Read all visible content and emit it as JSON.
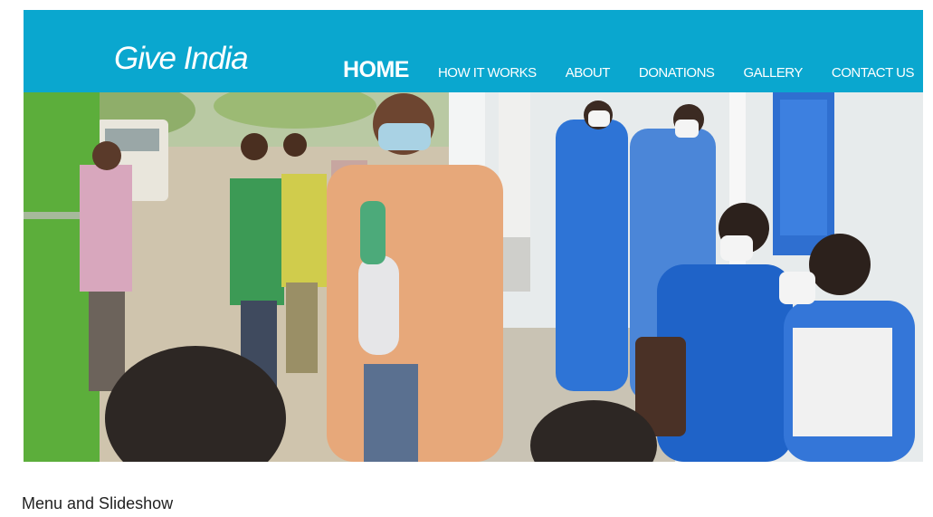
{
  "header": {
    "logo": "Give India",
    "nav": [
      {
        "label": "HOME",
        "active": true
      },
      {
        "label": "HOW IT WORKS",
        "active": false
      },
      {
        "label": "ABOUT",
        "active": false
      },
      {
        "label": "DONATIONS",
        "active": false
      },
      {
        "label": "GALLERY",
        "active": false
      },
      {
        "label": "CONTACT US",
        "active": false
      }
    ]
  },
  "slideshow": {
    "image": "photo-screening-queue"
  },
  "caption": "Menu and Slideshow",
  "colors": {
    "header_bg": "#0aa7cf",
    "nav_text": "#ffffff",
    "caption_text": "#222222"
  }
}
